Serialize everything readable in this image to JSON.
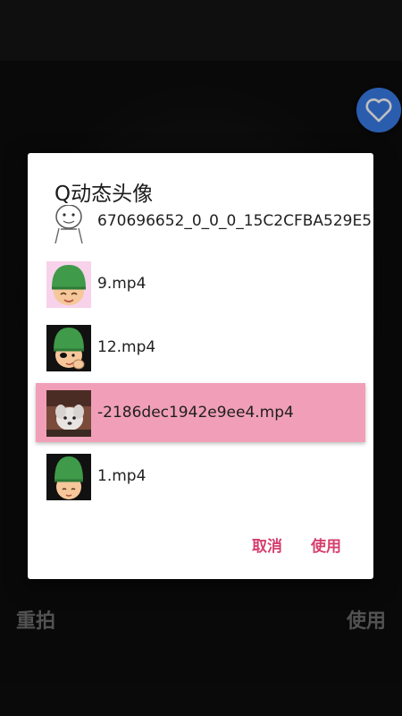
{
  "dialog": {
    "title": "Q动态头像",
    "items": [
      {
        "label": "670696652_0_0_0_15C2CFBA529E5",
        "thumb": "sketch-character-icon",
        "selected": false
      },
      {
        "label": "9.mp4",
        "thumb": "green-helmet-boy-icon",
        "selected": false
      },
      {
        "label": "12.mp4",
        "thumb": "green-helmet-boy-dark-icon",
        "selected": false
      },
      {
        "label": "-2186dec1942e9ee4.mp4",
        "thumb": "white-dog-photo-icon",
        "selected": true
      },
      {
        "label": "1.mp4",
        "thumb": "green-helmet-boy-dark-icon",
        "selected": false
      }
    ],
    "cancel_label": "取消",
    "use_label": "使用"
  },
  "bottom": {
    "retake_label": "重拍",
    "use_label": "使用"
  },
  "colors": {
    "accent": "#d63f6f",
    "selected_row": "#f19fb8",
    "favorite_button": "#3a7de8"
  }
}
